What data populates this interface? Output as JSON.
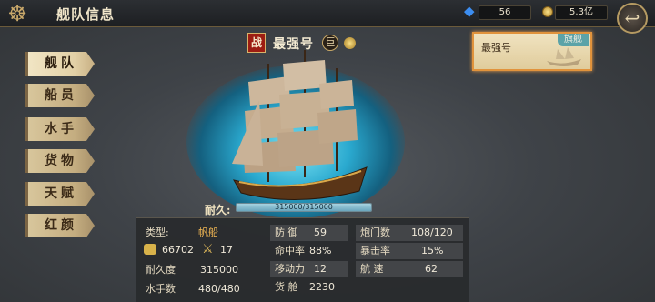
{
  "header": {
    "title": "舰队信息",
    "gems": "56",
    "gold": "5.3亿"
  },
  "nav": {
    "items": [
      {
        "label": "舰队"
      },
      {
        "label": "船员"
      },
      {
        "label": "水手"
      },
      {
        "label": "货物"
      },
      {
        "label": "天赋"
      },
      {
        "label": "红颜"
      }
    ]
  },
  "ship": {
    "battle_tag": "战",
    "name": "最强号",
    "grade": "巨",
    "durability_label": "耐久:",
    "durability_text": "315000/315000",
    "durability_fraction": 1.0
  },
  "card": {
    "name": "最强号",
    "tag": "旗舰"
  },
  "stats": {
    "type_label": "类型:",
    "type_value": "帆船",
    "food": "66702",
    "attack": "17",
    "durability_label": "耐久度",
    "durability_value": "315000",
    "sailors_label": "水手数",
    "sailors_value": "480/480",
    "defense_label": "防  御",
    "defense_value": "59",
    "accuracy_label": "命中率",
    "accuracy_value": "88%",
    "mobility_label": "移动力",
    "mobility_value": "12",
    "cargo_label": "货  舱",
    "cargo_value": "2230",
    "gunports_label": "炮门数",
    "gunports_value": "108/120",
    "crit_label": "暴击率",
    "crit_value": "15%",
    "speed_label": "航  速",
    "speed_value": "62"
  },
  "colors": {
    "accent": "#e1933c",
    "type_value": "#f0b653",
    "sea": "#2aa9cf"
  }
}
